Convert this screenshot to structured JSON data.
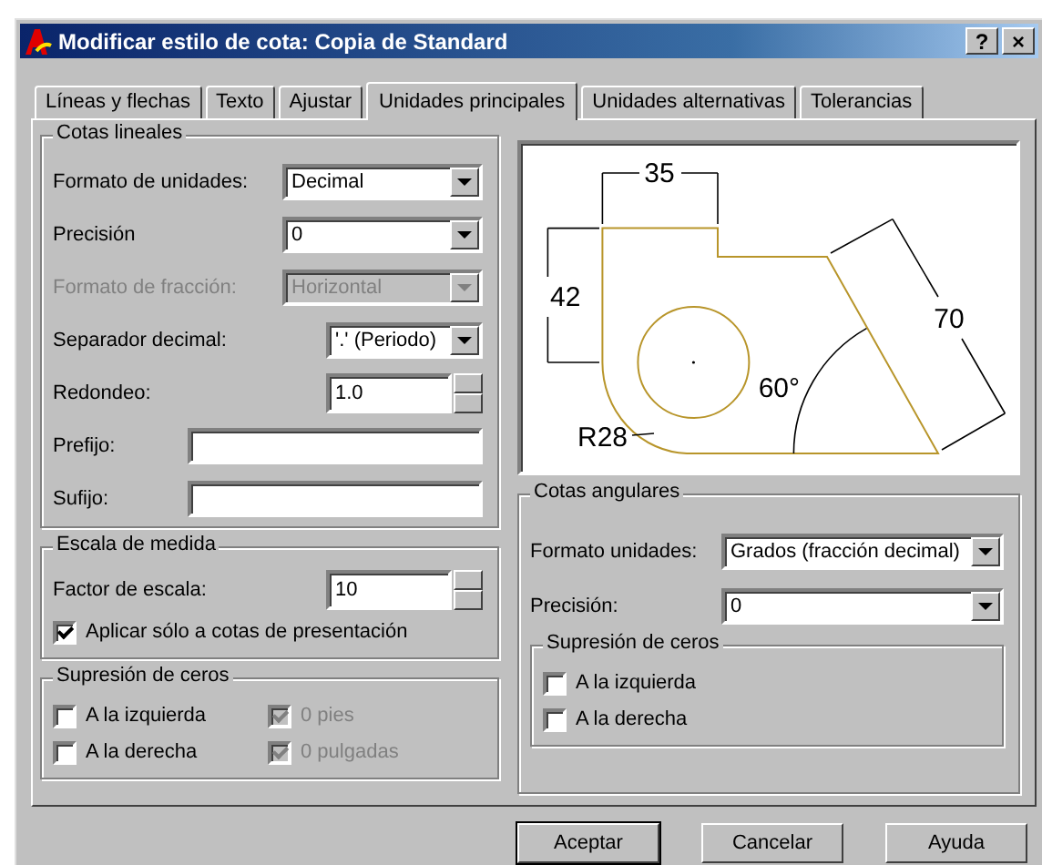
{
  "window": {
    "title": "Modificar estilo de cota: Copia de Standard",
    "controls": [
      {
        "label": "?"
      },
      {
        "label": "×"
      }
    ]
  },
  "tabs": [
    {
      "label": "Líneas y flechas",
      "selected": false
    },
    {
      "label": "Texto",
      "selected": false
    },
    {
      "label": "Ajustar",
      "selected": false
    },
    {
      "label": "Unidades principales",
      "selected": true
    },
    {
      "label": "Unidades alternativas",
      "selected": false
    },
    {
      "label": "Tolerancias",
      "selected": false
    }
  ],
  "linear": {
    "title": "Cotas lineales",
    "fields": [
      {
        "label": "Formato de unidades:",
        "kind": "combo",
        "value": "Decimal",
        "disabled": false
      },
      {
        "label": "Precisión",
        "kind": "combo",
        "value": "0",
        "disabled": false
      },
      {
        "label": "Formato de fracción:",
        "kind": "combo",
        "value": "Horizontal",
        "disabled": true
      },
      {
        "label": "Separador decimal:",
        "kind": "combo",
        "value": "'.' (Periodo)",
        "disabled": false
      },
      {
        "label": "Redondeo:",
        "kind": "spin",
        "value": "1.0",
        "disabled": false
      },
      {
        "label": "Prefijo:",
        "kind": "text",
        "disabled": false
      },
      {
        "label": "Sufijo:",
        "kind": "text",
        "disabled": false
      }
    ]
  },
  "scale": {
    "title": "Escala de medida",
    "fields": [
      {
        "label": "Factor de escala:",
        "kind": "spin",
        "value": "10",
        "disabled": false
      }
    ],
    "checkbox": {
      "label": "Aplicar sólo a cotas de presentación",
      "checked": true
    }
  },
  "linear_zeros": {
    "title": "Supresión de ceros",
    "options": [
      {
        "label": "A la izquierda",
        "checked": false,
        "disabled": false
      },
      {
        "label": "0 pies",
        "checked": true,
        "disabled": true
      },
      {
        "label": "A la derecha",
        "checked": false,
        "disabled": false
      },
      {
        "label": "0 pulgadas",
        "checked": true,
        "disabled": true
      }
    ]
  },
  "preview": {
    "labels": [
      {
        "kind": "top",
        "text": "35"
      },
      {
        "kind": "left",
        "text": "42"
      },
      {
        "kind": "diagonal",
        "text": "70"
      },
      {
        "kind": "angle",
        "text": "60°"
      },
      {
        "kind": "radius",
        "text": "R28"
      }
    ]
  },
  "angular": {
    "title": "Cotas angulares",
    "fields": [
      {
        "label": "Formato unidades:",
        "kind": "combo",
        "value": "Grados (fracción decimal)",
        "disabled": false
      },
      {
        "label": "Precisión:",
        "kind": "combo",
        "value": "0",
        "disabled": false
      }
    ]
  },
  "angular_zeros": {
    "title": "Supresión de ceros",
    "options": [
      {
        "label": "A la izquierda",
        "checked": false,
        "disabled": false
      },
      {
        "label": "A la derecha",
        "checked": false,
        "disabled": false
      }
    ]
  },
  "buttons": [
    {
      "label": "Aceptar",
      "default": true
    },
    {
      "label": "Cancelar",
      "default": false
    },
    {
      "label": "Ayuda",
      "default": false
    }
  ]
}
